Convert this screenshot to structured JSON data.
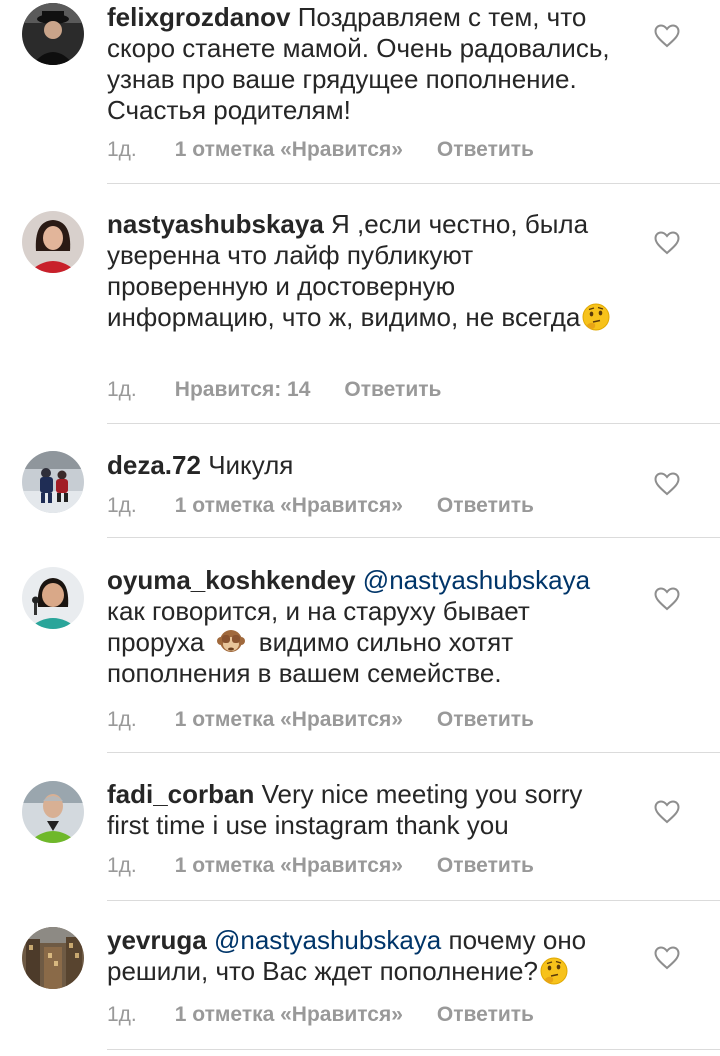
{
  "comments": [
    {
      "username": "felixgrozdanov",
      "text": "Поздравляем с тем, что скоро  станете мамой. Очень радовались, узнав про ваше грядущее пополнение. Счастья родителям!",
      "time": "1д.",
      "likes": "1 отметка «Нравится»",
      "reply": "Ответить",
      "avatar_icon": "avatar-photo-man-hat"
    },
    {
      "username": "nastyashubskaya",
      "text": "Я ,если честно, была уверенна что лайф публикуют проверенную и достоверную информацию, что ж, видимо, не всегда",
      "emoji": "thinking-face",
      "time": "1д.",
      "likes": "Нравится: 14",
      "reply": "Ответить",
      "avatar_icon": "avatar-photo-woman-red"
    },
    {
      "username": "deza.72",
      "text": "Чикуля",
      "time": "1д.",
      "likes": "1 отметка «Нравится»",
      "reply": "Ответить",
      "avatar_icon": "avatar-photo-hockey"
    },
    {
      "username": "oyuma_koshkendey",
      "mention": "@nastyashubskaya",
      "text_a": "как говорится, и на старуху бывает проруха",
      "emoji": "see-no-evil-monkey",
      "text_b": " видимо сильно хотят пополнения в вашем семействе.",
      "time": "1д.",
      "likes": "1 отметка «Нравится»",
      "reply": "Ответить",
      "avatar_icon": "avatar-photo-woman-microphone"
    },
    {
      "username": "fadi_corban",
      "text": "Very nice meeting you sorry first time i use instagram thank you",
      "time": "1д.",
      "likes": "1 отметка «Нравится»",
      "reply": "Ответить",
      "avatar_icon": "avatar-photo-man-green-jacket"
    },
    {
      "username": "yevruga",
      "mention": "@nastyashubskaya",
      "text": "почему оно решили, что Вас ждет пополнение?",
      "emoji": "thinking-face",
      "time": "1д.",
      "likes": "1 отметка «Нравится»",
      "reply": "Ответить",
      "avatar_icon": "avatar-photo-city-street"
    }
  ],
  "colors": {
    "text": "#262626",
    "meta": "#999999",
    "mention": "#003569",
    "divider": "#dbdbdb",
    "heart": "#8e8e8e"
  }
}
